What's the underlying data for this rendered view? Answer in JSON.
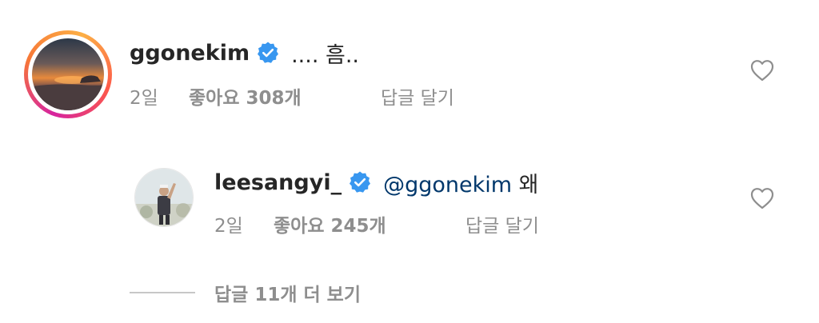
{
  "comments": [
    {
      "username": "ggonekim",
      "verified": true,
      "text": ".... 흠..",
      "time": "2일",
      "likes": "좋아요 308개",
      "reply": "답글 달기",
      "avatar": "sunset-avatar",
      "story_ring": true
    }
  ],
  "reply_comment": {
    "username": "leesangyi_",
    "verified": true,
    "mention": "@ggonekim",
    "text": "왜",
    "time": "2일",
    "likes": "좋아요 245개",
    "reply": "답글 달기",
    "avatar": "person-avatar"
  },
  "view_more": {
    "label": "답글 11개 더 보기"
  },
  "colors": {
    "verified_badge": "#3897f0",
    "mention": "#00376b",
    "muted_text": "#8e8e8e",
    "primary_text": "#262626"
  },
  "icons": [
    "verified-badge-icon",
    "heart-icon"
  ]
}
